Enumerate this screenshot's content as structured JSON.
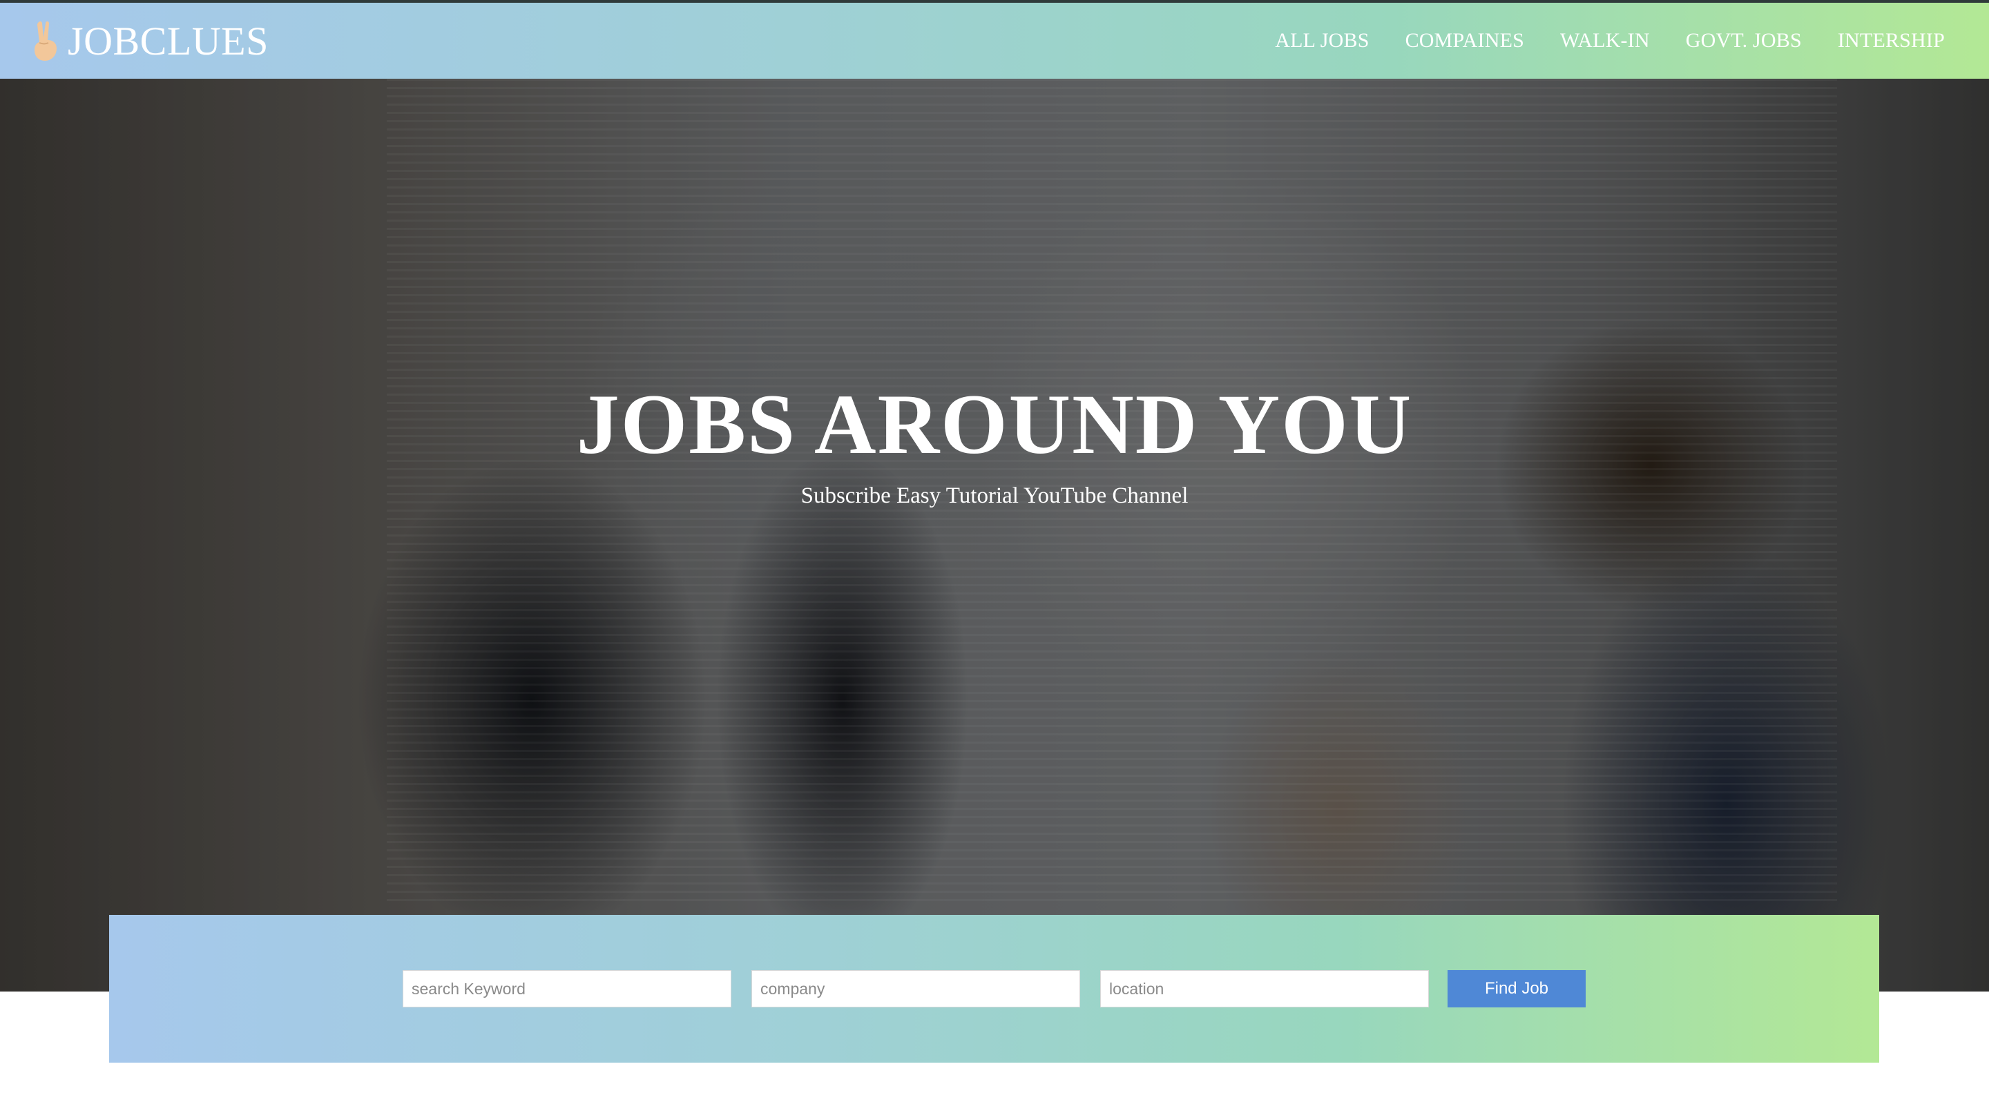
{
  "navbar": {
    "brand": "JOBCLUES",
    "brand_icon": "victory-hand-icon",
    "links": [
      "ALL JOBS",
      "COMPAINES",
      "WALK-IN",
      "GOVT. JOBS",
      "INTERSHIP"
    ]
  },
  "hero": {
    "title": "JOBS AROUND YOU",
    "subtitle": "Subscribe Easy Tutorial YouTube Channel"
  },
  "search": {
    "keyword_placeholder": "search Keyword",
    "company_placeholder": "company",
    "location_placeholder": "location",
    "button_label": "Find Job"
  },
  "colors": {
    "gradient_start": "#a6c8ec",
    "gradient_end": "#b3e895",
    "button": "#4f88d6"
  }
}
